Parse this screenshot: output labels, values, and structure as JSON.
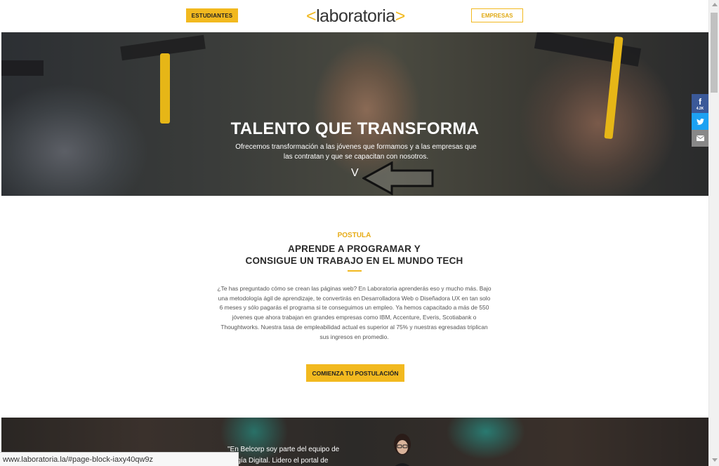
{
  "header": {
    "students_label": "ESTUDIANTES",
    "companies_label": "EMPRESAS",
    "logo_text": "laboratoria",
    "logo_open": "<",
    "logo_close": ">"
  },
  "hero": {
    "title": "TALENTO QUE TRANSFORMA",
    "subtitle_line1": "Ofrecemos transformación a las jóvenes que formamos y a las empresas que",
    "subtitle_line2": "las contratan y que se capacitan con nosotros.",
    "chevron": "V"
  },
  "social": {
    "facebook_glyph": "f",
    "facebook_count": "4.2K",
    "twitter_glyph": "🐦",
    "email_glyph": "✉"
  },
  "postula": {
    "eyebrow": "POSTULA",
    "headline_line1": "APRENDE A PROGRAMAR Y",
    "headline_line2": "CONSIGUE UN TRABAJO EN EL MUNDO TECH",
    "paragraph": "¿Te has preguntado cómo se crean las páginas web? En Laboratoria aprenderás eso y mucho más. Bajo una metodología ágil de aprendizaje, te convertirás en Desarrolladora Web o Diseñadora UX en tan solo 6 meses y sólo pagarás el programa si te conseguimos un empleo. Ya hemos capacitado a más de 550 jóvenes que ahora trabajan en grandes empresas como IBM, Accenture, Everis, Scotiabank o Thoughtworks. Nuestra tasa de empleabilidad actual es superior al 75% y nuestras egresadas triplican sus ingresos en promedio.",
    "cta_label": "COMIENZA TU POSTULACIÓN"
  },
  "testimonial": {
    "line1": "\"En Belcorp soy parte del equipo de",
    "line2": "ología Digital. Lidero el portal de"
  },
  "status_bar": {
    "url": "www.laboratoria.la/#page-block-iaxy40qw9z"
  }
}
